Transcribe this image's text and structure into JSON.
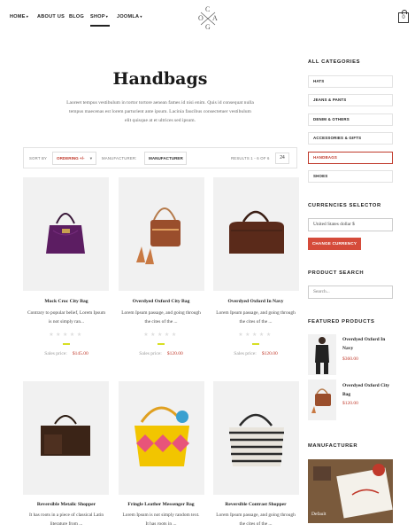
{
  "nav": {
    "items": [
      {
        "label": "HOME",
        "caret": "▾"
      },
      {
        "label": "ABOUT US",
        "caret": ""
      },
      {
        "label": "BLOG",
        "caret": ""
      },
      {
        "label": "SHOP",
        "caret": "▾"
      },
      {
        "label": "JOOMLA",
        "caret": "▾"
      }
    ],
    "logo_letters": [
      "C",
      "O",
      "A",
      "G"
    ],
    "cart_count": "0"
  },
  "main": {
    "title": "Handbags",
    "intro": "Laoreet tempus vestibulum in tortor tortore aenean fames id nisi enim. Quis id consequat nulla tempus maecenas est lorem parturient ante ipsum. Lacinia faucibus consectetuer vestibulum elit quisque at et ultrices sed ipsum.",
    "toolbar": {
      "sort_label": "SORT BY",
      "sort_value": "ORDERING +/-",
      "manufacturer_label": "MANUFACTURER:",
      "manufacturer_value": "MANUFACTURER",
      "results_text": "RESULTS 1 - 6 OF 6",
      "per_page": "24"
    },
    "products": [
      {
        "name": "Mock Croc City Bag",
        "desc1": "Contrary to popular belief, Lorem Ipsum",
        "desc2": "is not simply ran...",
        "stars": "★★★★★",
        "price_label": "Sales price:",
        "price": "$145.00"
      },
      {
        "name": "Overdyed Oxford City Bag",
        "desc1": "Lorem Ipsum passage, and going through",
        "desc2": "the cites of the ...",
        "stars": "★★★★★",
        "price_label": "Sales price:",
        "price": "$120.00"
      },
      {
        "name": "Overdyed Oxford In Navy",
        "desc1": "Lorem Ipsum passage, and going through",
        "desc2": "the cites of the ...",
        "stars": "★★★★★",
        "price_label": "Sales price:",
        "price": "$120.00"
      },
      {
        "name": "Reversible Metalic Shopper",
        "desc1": "It has roots in a piece of classical Latin",
        "desc2": "literature from ...",
        "stars": "★★★★★",
        "price_label": "",
        "price": ""
      },
      {
        "name": "Fringle Leather Messenger Bag",
        "desc1": "Lorem Ipsum is not simply random text.",
        "desc2": "It has roots in ...",
        "stars": "★★★★★",
        "price_label": "",
        "price": ""
      },
      {
        "name": "Reversible Contrast Shopper",
        "desc1": "Lorem Ipsum passage, and going through",
        "desc2": "the cites of the ...",
        "stars": "★★★★★",
        "price_label": "",
        "price": ""
      }
    ]
  },
  "sidebar": {
    "categories_heading": "ALL CATEGORIES",
    "categories": [
      "HATS",
      "JEANS & PANTS",
      "DENIM & OTHERS",
      "ACCESSORIES & GIFTS",
      "HANDBAGS",
      "SHOES"
    ],
    "currency_heading": "CURRENCIES SELECTOR",
    "currency_value": "United States dollar $",
    "currency_button": "CHANGE CURRENCY",
    "search_heading": "PRODUCT SEARCH",
    "search_placeholder": "Search...",
    "featured_heading": "FEATURED PRODUCTS",
    "featured": [
      {
        "name1": "Overdyed Oxford In",
        "name2": "Navy",
        "price": "$360.00"
      },
      {
        "name1": "Overdyed Oxford City",
        "name2": "Bag",
        "price": "$120.00"
      }
    ],
    "manufacturer_heading": "MANUFACTURER",
    "manufacturer_label": "Default"
  },
  "colors": {
    "accent": "#c0392b",
    "button": "#d54b3a",
    "rating_bar": "#d7df23"
  }
}
